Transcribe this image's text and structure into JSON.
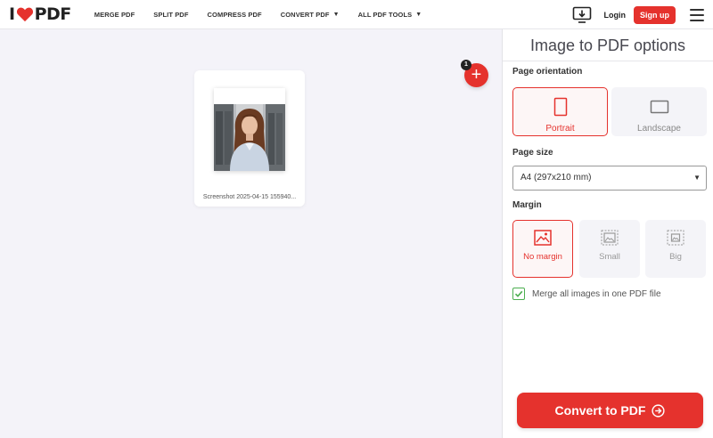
{
  "header": {
    "logo_prefix": "I",
    "logo_suffix": "PDF",
    "nav": [
      {
        "label": "MERGE PDF"
      },
      {
        "label": "SPLIT PDF"
      },
      {
        "label": "COMPRESS PDF"
      },
      {
        "label": "CONVERT PDF",
        "has_dropdown": true
      },
      {
        "label": "ALL PDF TOOLS",
        "has_dropdown": true
      }
    ],
    "login_label": "Login",
    "signup_label": "Sign up"
  },
  "workspace": {
    "file_name": "Screenshot 2025-04-15 155940...",
    "file_count": "1",
    "add_icon": "plus-icon"
  },
  "sidebar": {
    "title": "Image to PDF options",
    "orientation": {
      "label": "Page orientation",
      "options": [
        "Portrait",
        "Landscape"
      ],
      "selected": "Portrait"
    },
    "page_size": {
      "label": "Page size",
      "value": "A4 (297x210 mm)"
    },
    "margin": {
      "label": "Margin",
      "options": [
        "No margin",
        "Small",
        "Big"
      ],
      "selected": "No margin"
    },
    "merge": {
      "label": "Merge all images in one PDF file",
      "checked": true
    },
    "convert_label": "Convert to PDF"
  },
  "colors": {
    "accent": "#e5322d",
    "check": "#4caf50"
  }
}
